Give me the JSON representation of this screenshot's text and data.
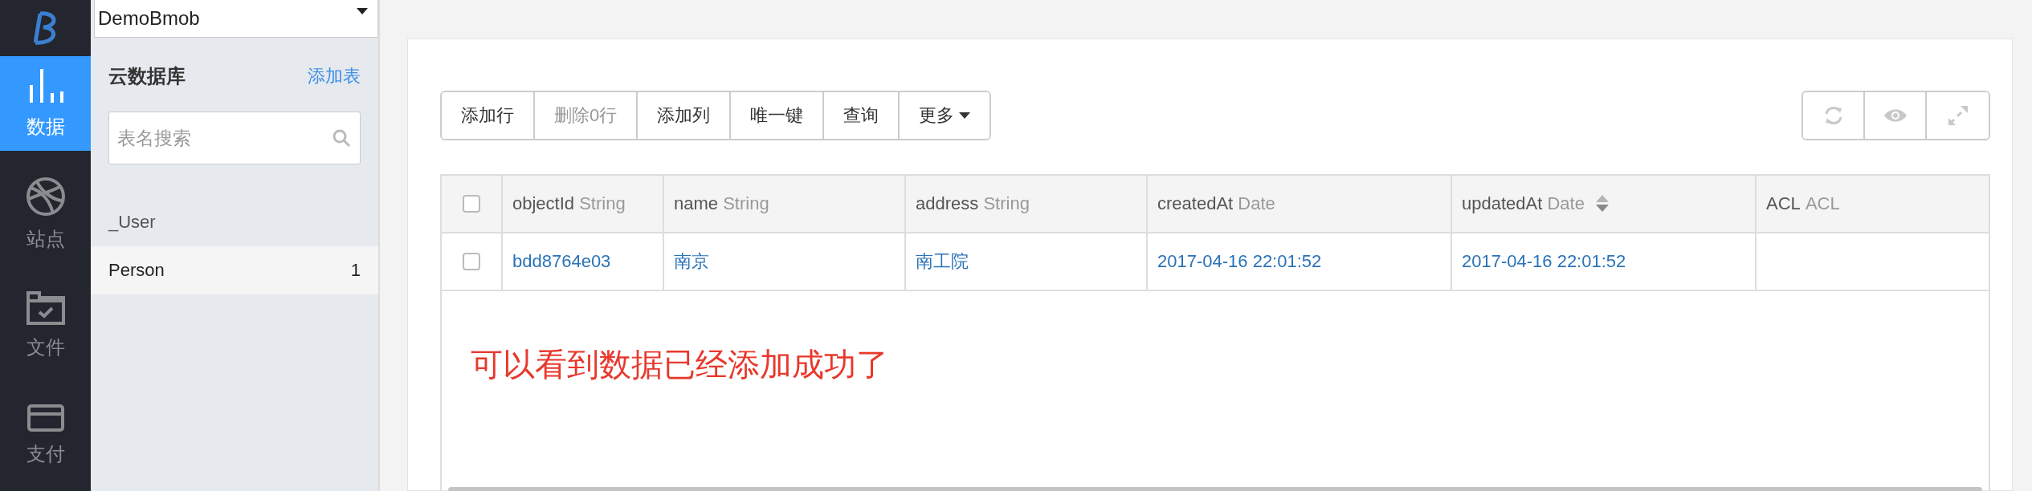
{
  "nav": {
    "items": [
      {
        "label": "数据",
        "kind": "chart",
        "selected": true
      },
      {
        "label": "站点",
        "kind": "globe",
        "selected": false
      },
      {
        "label": "文件",
        "kind": "folder",
        "selected": false
      },
      {
        "label": "支付",
        "kind": "card",
        "selected": false
      }
    ]
  },
  "app_select": {
    "value": "DemoBmob"
  },
  "sidebar": {
    "title": "云数据库",
    "add_link": "添加表",
    "search": {
      "placeholder": "表名搜索"
    },
    "items": [
      {
        "name": "_User",
        "selected": false
      },
      {
        "name": "Person",
        "count": "1",
        "selected": true
      }
    ]
  },
  "toolbar": {
    "buttons": [
      {
        "label": "添加行",
        "disabled": false
      },
      {
        "label": "删除0行",
        "disabled": true
      },
      {
        "label": "添加列",
        "disabled": false
      },
      {
        "label": "唯一键",
        "disabled": false
      },
      {
        "label": "查询",
        "disabled": false
      },
      {
        "label": "更多",
        "disabled": false,
        "dropdown": true
      }
    ],
    "icon_buttons": [
      {
        "kind": "refresh"
      },
      {
        "kind": "eye"
      },
      {
        "kind": "expand"
      }
    ]
  },
  "table": {
    "all_checked": false,
    "columns": [
      {
        "name": "objectId",
        "type": "String",
        "sortable": false
      },
      {
        "name": "name",
        "type": "String",
        "sortable": false
      },
      {
        "name": "address",
        "type": "String",
        "sortable": false
      },
      {
        "name": "createdAt",
        "type": "Date",
        "sortable": false
      },
      {
        "name": "updatedAt",
        "type": "Date",
        "sortable": true
      },
      {
        "name": "ACL",
        "type": "ACL",
        "sortable": false
      }
    ],
    "rows": [
      {
        "checked": false,
        "cells": [
          "bdd8764e03",
          "南京",
          "南工院",
          "2017-04-16 22:01:52",
          "2017-04-16 22:01:52",
          ""
        ]
      }
    ]
  },
  "annotation": "可以看到数据已经添加成功了"
}
